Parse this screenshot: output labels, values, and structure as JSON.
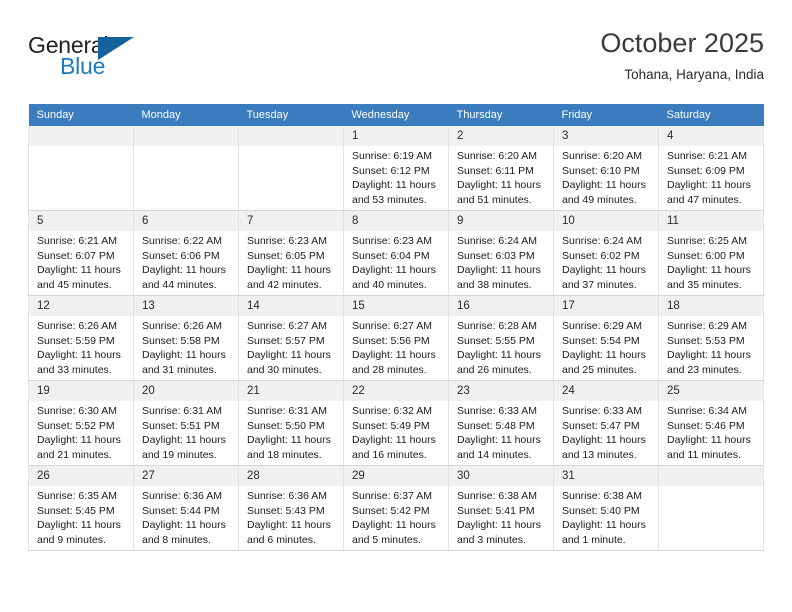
{
  "brand": {
    "name_top": "General",
    "name_bottom": "Blue",
    "accent_color": "#1f7ac0",
    "triangle_color": "#14619e"
  },
  "header": {
    "title": "October 2025",
    "location": "Tohana, Haryana, India"
  },
  "calendar": {
    "header_bg": "#3a7cbe",
    "weekdays": [
      "Sunday",
      "Monday",
      "Tuesday",
      "Wednesday",
      "Thursday",
      "Friday",
      "Saturday"
    ],
    "weeks": [
      [
        {
          "day": "",
          "empty": true
        },
        {
          "day": "",
          "empty": true
        },
        {
          "day": "",
          "empty": true
        },
        {
          "day": "1",
          "sunrise": "Sunrise: 6:19 AM",
          "sunset": "Sunset: 6:12 PM",
          "daylight1": "Daylight: 11 hours",
          "daylight2": "and 53 minutes."
        },
        {
          "day": "2",
          "sunrise": "Sunrise: 6:20 AM",
          "sunset": "Sunset: 6:11 PM",
          "daylight1": "Daylight: 11 hours",
          "daylight2": "and 51 minutes."
        },
        {
          "day": "3",
          "sunrise": "Sunrise: 6:20 AM",
          "sunset": "Sunset: 6:10 PM",
          "daylight1": "Daylight: 11 hours",
          "daylight2": "and 49 minutes."
        },
        {
          "day": "4",
          "sunrise": "Sunrise: 6:21 AM",
          "sunset": "Sunset: 6:09 PM",
          "daylight1": "Daylight: 11 hours",
          "daylight2": "and 47 minutes."
        }
      ],
      [
        {
          "day": "5",
          "sunrise": "Sunrise: 6:21 AM",
          "sunset": "Sunset: 6:07 PM",
          "daylight1": "Daylight: 11 hours",
          "daylight2": "and 45 minutes."
        },
        {
          "day": "6",
          "sunrise": "Sunrise: 6:22 AM",
          "sunset": "Sunset: 6:06 PM",
          "daylight1": "Daylight: 11 hours",
          "daylight2": "and 44 minutes."
        },
        {
          "day": "7",
          "sunrise": "Sunrise: 6:23 AM",
          "sunset": "Sunset: 6:05 PM",
          "daylight1": "Daylight: 11 hours",
          "daylight2": "and 42 minutes."
        },
        {
          "day": "8",
          "sunrise": "Sunrise: 6:23 AM",
          "sunset": "Sunset: 6:04 PM",
          "daylight1": "Daylight: 11 hours",
          "daylight2": "and 40 minutes."
        },
        {
          "day": "9",
          "sunrise": "Sunrise: 6:24 AM",
          "sunset": "Sunset: 6:03 PM",
          "daylight1": "Daylight: 11 hours",
          "daylight2": "and 38 minutes."
        },
        {
          "day": "10",
          "sunrise": "Sunrise: 6:24 AM",
          "sunset": "Sunset: 6:02 PM",
          "daylight1": "Daylight: 11 hours",
          "daylight2": "and 37 minutes."
        },
        {
          "day": "11",
          "sunrise": "Sunrise: 6:25 AM",
          "sunset": "Sunset: 6:00 PM",
          "daylight1": "Daylight: 11 hours",
          "daylight2": "and 35 minutes."
        }
      ],
      [
        {
          "day": "12",
          "sunrise": "Sunrise: 6:26 AM",
          "sunset": "Sunset: 5:59 PM",
          "daylight1": "Daylight: 11 hours",
          "daylight2": "and 33 minutes."
        },
        {
          "day": "13",
          "sunrise": "Sunrise: 6:26 AM",
          "sunset": "Sunset: 5:58 PM",
          "daylight1": "Daylight: 11 hours",
          "daylight2": "and 31 minutes."
        },
        {
          "day": "14",
          "sunrise": "Sunrise: 6:27 AM",
          "sunset": "Sunset: 5:57 PM",
          "daylight1": "Daylight: 11 hours",
          "daylight2": "and 30 minutes."
        },
        {
          "day": "15",
          "sunrise": "Sunrise: 6:27 AM",
          "sunset": "Sunset: 5:56 PM",
          "daylight1": "Daylight: 11 hours",
          "daylight2": "and 28 minutes."
        },
        {
          "day": "16",
          "sunrise": "Sunrise: 6:28 AM",
          "sunset": "Sunset: 5:55 PM",
          "daylight1": "Daylight: 11 hours",
          "daylight2": "and 26 minutes."
        },
        {
          "day": "17",
          "sunrise": "Sunrise: 6:29 AM",
          "sunset": "Sunset: 5:54 PM",
          "daylight1": "Daylight: 11 hours",
          "daylight2": "and 25 minutes."
        },
        {
          "day": "18",
          "sunrise": "Sunrise: 6:29 AM",
          "sunset": "Sunset: 5:53 PM",
          "daylight1": "Daylight: 11 hours",
          "daylight2": "and 23 minutes."
        }
      ],
      [
        {
          "day": "19",
          "sunrise": "Sunrise: 6:30 AM",
          "sunset": "Sunset: 5:52 PM",
          "daylight1": "Daylight: 11 hours",
          "daylight2": "and 21 minutes."
        },
        {
          "day": "20",
          "sunrise": "Sunrise: 6:31 AM",
          "sunset": "Sunset: 5:51 PM",
          "daylight1": "Daylight: 11 hours",
          "daylight2": "and 19 minutes."
        },
        {
          "day": "21",
          "sunrise": "Sunrise: 6:31 AM",
          "sunset": "Sunset: 5:50 PM",
          "daylight1": "Daylight: 11 hours",
          "daylight2": "and 18 minutes."
        },
        {
          "day": "22",
          "sunrise": "Sunrise: 6:32 AM",
          "sunset": "Sunset: 5:49 PM",
          "daylight1": "Daylight: 11 hours",
          "daylight2": "and 16 minutes."
        },
        {
          "day": "23",
          "sunrise": "Sunrise: 6:33 AM",
          "sunset": "Sunset: 5:48 PM",
          "daylight1": "Daylight: 11 hours",
          "daylight2": "and 14 minutes."
        },
        {
          "day": "24",
          "sunrise": "Sunrise: 6:33 AM",
          "sunset": "Sunset: 5:47 PM",
          "daylight1": "Daylight: 11 hours",
          "daylight2": "and 13 minutes."
        },
        {
          "day": "25",
          "sunrise": "Sunrise: 6:34 AM",
          "sunset": "Sunset: 5:46 PM",
          "daylight1": "Daylight: 11 hours",
          "daylight2": "and 11 minutes."
        }
      ],
      [
        {
          "day": "26",
          "sunrise": "Sunrise: 6:35 AM",
          "sunset": "Sunset: 5:45 PM",
          "daylight1": "Daylight: 11 hours",
          "daylight2": "and 9 minutes."
        },
        {
          "day": "27",
          "sunrise": "Sunrise: 6:36 AM",
          "sunset": "Sunset: 5:44 PM",
          "daylight1": "Daylight: 11 hours",
          "daylight2": "and 8 minutes."
        },
        {
          "day": "28",
          "sunrise": "Sunrise: 6:36 AM",
          "sunset": "Sunset: 5:43 PM",
          "daylight1": "Daylight: 11 hours",
          "daylight2": "and 6 minutes."
        },
        {
          "day": "29",
          "sunrise": "Sunrise: 6:37 AM",
          "sunset": "Sunset: 5:42 PM",
          "daylight1": "Daylight: 11 hours",
          "daylight2": "and 5 minutes."
        },
        {
          "day": "30",
          "sunrise": "Sunrise: 6:38 AM",
          "sunset": "Sunset: 5:41 PM",
          "daylight1": "Daylight: 11 hours",
          "daylight2": "and 3 minutes."
        },
        {
          "day": "31",
          "sunrise": "Sunrise: 6:38 AM",
          "sunset": "Sunset: 5:40 PM",
          "daylight1": "Daylight: 11 hours",
          "daylight2": "and 1 minute."
        },
        {
          "day": "",
          "empty": true
        }
      ]
    ]
  }
}
